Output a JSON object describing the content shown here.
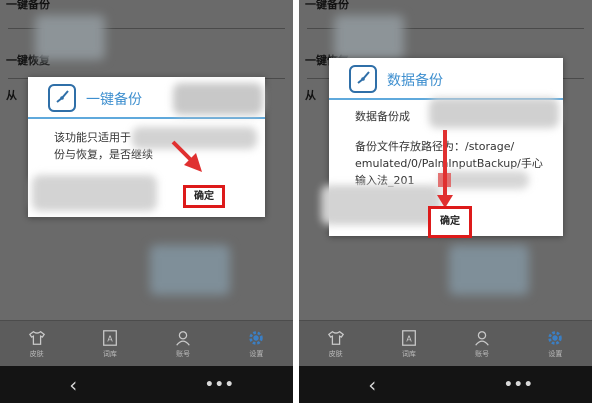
{
  "left": {
    "background": {
      "row1": "一键备份",
      "row2": "一键恢复",
      "row3": "从"
    },
    "dialog": {
      "icon": "clock-icon",
      "title": "一键备份",
      "body_line1": "该功能只适用于",
      "body_line2": "份与恢复，是否继续",
      "ok_label": "确定"
    }
  },
  "right": {
    "background": {
      "row1": "一键备份",
      "row2": "一键恢复",
      "row3": "从"
    },
    "dialog": {
      "icon": "clock-icon",
      "title": "数据备份",
      "status": "数据备份成",
      "path_line1": "备份文件存放路径为：/storage/",
      "path_line2": "emulated/0/PalmInputBackup/手心",
      "path_line3": "输入法_201",
      "ok_label": "确定"
    }
  },
  "tabbar": [
    {
      "label": "皮肤",
      "icon": "tshirt-icon"
    },
    {
      "label": "词库",
      "icon": "letter-a-icon"
    },
    {
      "label": "账号",
      "icon": "person-icon"
    },
    {
      "label": "设置",
      "icon": "gear-icon"
    }
  ],
  "navbar": {
    "back": "‹",
    "menu": "•••"
  },
  "colors": {
    "accent": "#3e8fcf",
    "highlight": "#dd1a1a",
    "arrow": "#e03030"
  }
}
